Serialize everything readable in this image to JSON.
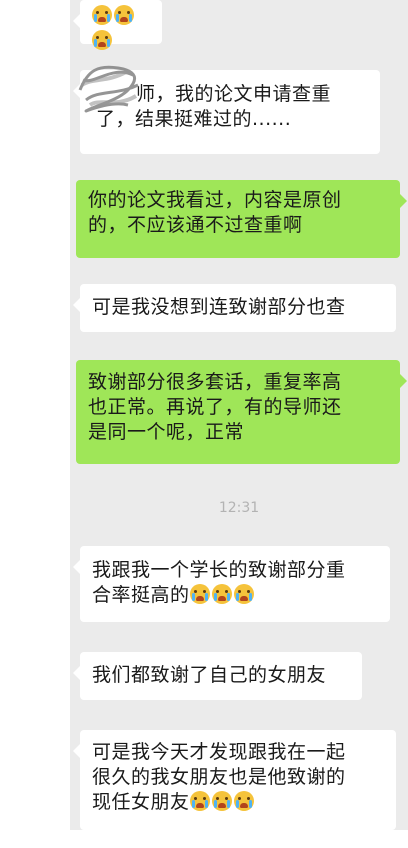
{
  "messages": [
    {
      "side": "in",
      "text": "",
      "emoji": 3
    },
    {
      "side": "in",
      "text": "老师，我的论文申请查重了，结果挺难过的……",
      "line1": "师，我的论文申请查重",
      "line2": "了，结果挺难过的......"
    },
    {
      "side": "out",
      "line1": "你的论文我看过，内容是原创",
      "line2": "的，不应该通不过查重啊"
    },
    {
      "side": "in",
      "line1": "可是我没想到连致谢部分也查"
    },
    {
      "side": "out",
      "line1": "致谢部分很多套话，重复率高",
      "line2": "也正常。再说了，有的导师还",
      "line3": "是同一个呢，正常"
    },
    {
      "side": "in",
      "line1": "我跟我一个学长的致谢部分重",
      "line2": "合率挺高的",
      "emoji": 3
    },
    {
      "side": "in",
      "line1": "我们都致谢了自己的女朋友"
    },
    {
      "side": "in",
      "line1": "可是我今天才发现跟我在一起",
      "line2": "很久的我女朋友也是他致谢的",
      "line3": "现任女朋友",
      "emoji": 3
    }
  ],
  "timestamp": "12:31",
  "emoji_name": "crying-face-emoji"
}
